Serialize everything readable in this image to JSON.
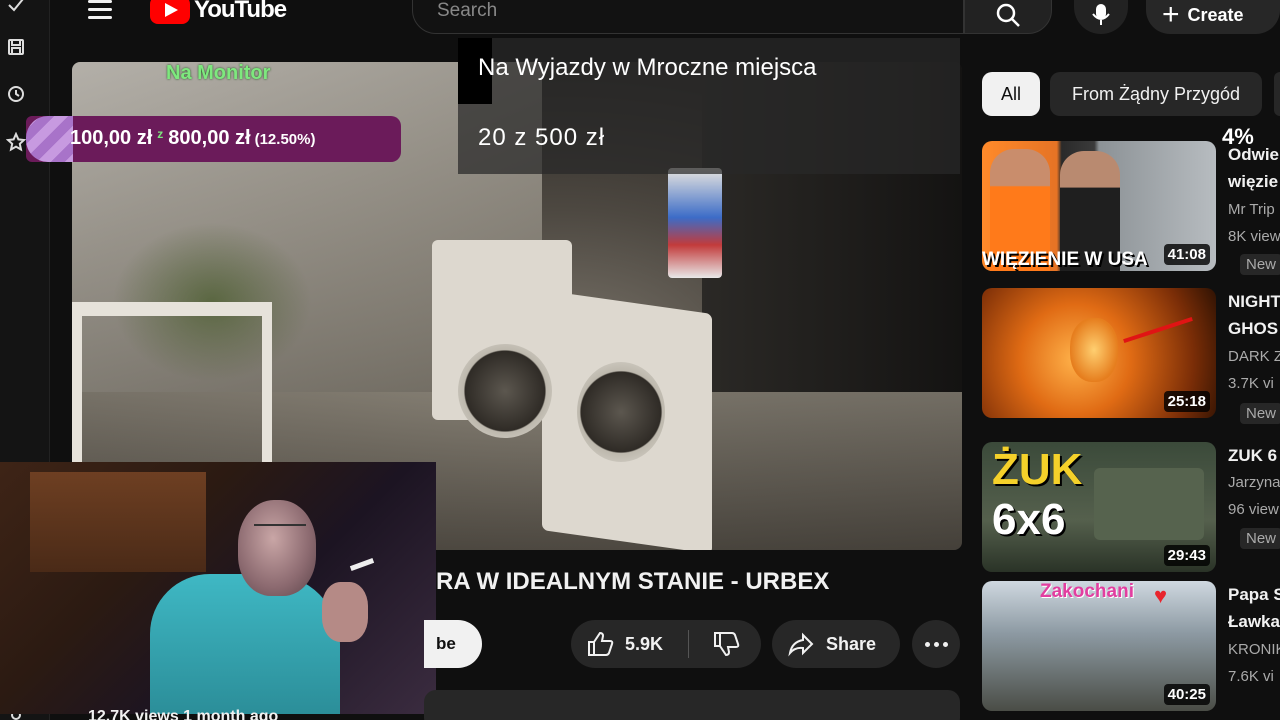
{
  "header": {
    "logo_text": "YouTube",
    "search_placeholder": "Search",
    "create_label": "Create"
  },
  "colors": {
    "background": "#0f0f0f",
    "brand_red": "#ff0000",
    "chip_active": "#f1f1f1",
    "donation_bar": "#6b1b5a",
    "monitor_label": "#7ee87e"
  },
  "icons": {
    "tool_strip": [
      "checkmark-icon",
      "save-icon",
      "history-icon",
      "star-icon"
    ],
    "header": [
      "menu-icon",
      "youtube-logo-icon",
      "search-icon",
      "mic-icon",
      "plus-icon"
    ],
    "actions": [
      "thumbs-up-icon",
      "thumbs-down-icon",
      "share-icon",
      "more-icon"
    ]
  },
  "overlay": {
    "monitor_label": "Na Monitor",
    "donation": {
      "current": "100,00 zł",
      "separator": "z",
      "target": "800,00 zł",
      "percent": "(12.50%)",
      "progress_fraction": 0.125
    },
    "goal_title": "Na Wyjazdy w Mroczne miejsca",
    "goal_progress": "20 z 500 zł",
    "goal_percent": "4%"
  },
  "video": {
    "title_visible": "RA W IDEALNYM STANIE - URBEX",
    "subscribe_partial": "be",
    "likes": "5.9K",
    "share_label": "Share",
    "views_line": "12.7K views  1 month ago"
  },
  "chips": [
    "All",
    "From Żądny Przygód"
  ],
  "recommendations": [
    {
      "title_lines": [
        "Odwie",
        "więzie"
      ],
      "channel": "Mr Trip",
      "views": "8K view",
      "badge": "New",
      "duration": "41:08",
      "thumb_caption": "WIĘZIENIE W USA"
    },
    {
      "title_lines": [
        "NIGHT",
        "GHOS"
      ],
      "channel": "DARK Z",
      "views": "3.7K vi",
      "badge": "New",
      "duration": "25:18"
    },
    {
      "title_lines": [
        "ZUK 6"
      ],
      "channel": "Jarzyna",
      "views": "96 view",
      "badge": "New",
      "duration": "29:43",
      "thumb_text_1": "ŻUK",
      "thumb_text_2": "6x6"
    },
    {
      "title_lines": [
        "Papa S",
        "Ławka"
      ],
      "channel": "KRONIK",
      "views": "7.6K vi",
      "duration": "40:25",
      "thumb_caption": "Zakochani"
    }
  ]
}
